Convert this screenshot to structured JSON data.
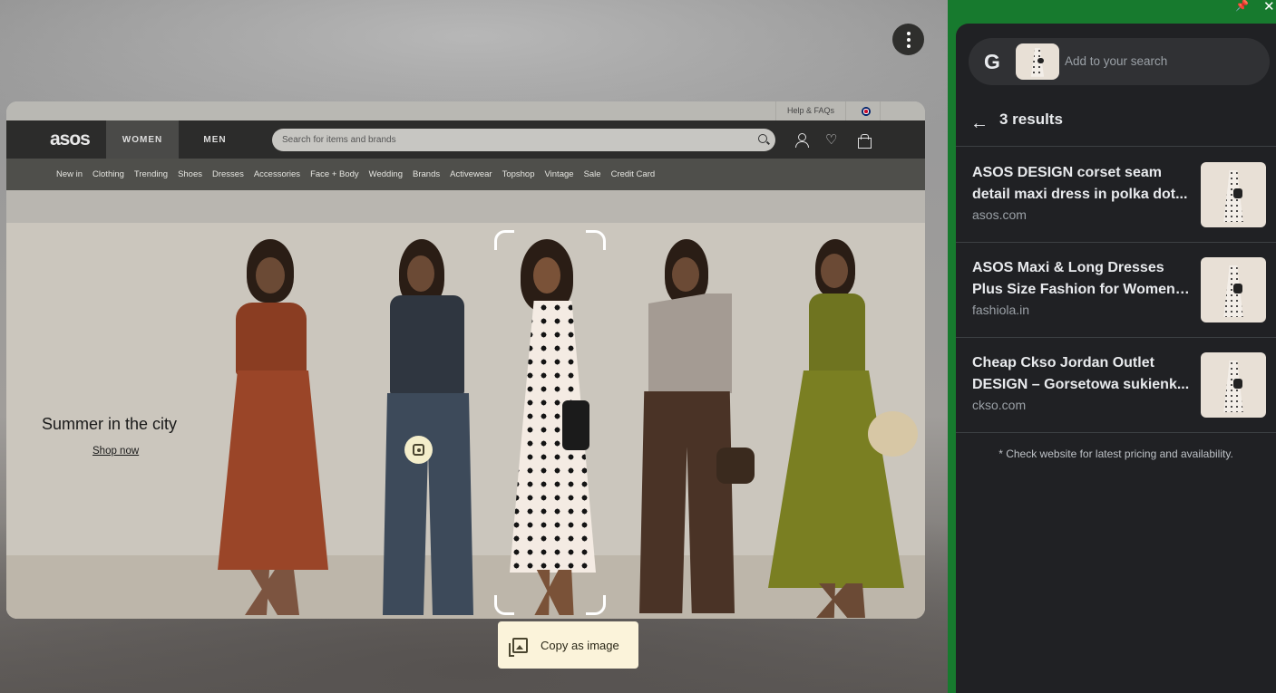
{
  "screen": {
    "menu_icon": "more-vert-icon"
  },
  "site": {
    "utility": {
      "help": "Help & FAQs",
      "flag_icon": "uk-flag-icon"
    },
    "logo": "asos",
    "tabs": [
      "WOMEN",
      "MEN"
    ],
    "search_placeholder": "Search for items and brands",
    "categories": [
      "New in",
      "Clothing",
      "Trending",
      "Shoes",
      "Dresses",
      "Accessories",
      "Face + Body",
      "Wedding",
      "Brands",
      "Activewear",
      "Topshop",
      "Vintage",
      "Sale",
      "Credit Card"
    ],
    "hero": {
      "title": "Summer in the city",
      "cta": "Shop now"
    }
  },
  "lens": {
    "copy_label": "Copy as image"
  },
  "panel": {
    "search_placeholder": "Add to your search",
    "results_count": "3 results",
    "results": [
      {
        "title_line1": "ASOS DESIGN corset seam",
        "title_line2": "detail maxi dress in polka dot...",
        "site": "asos.com"
      },
      {
        "title_line1": "ASOS Maxi & Long Dresses",
        "title_line2": "Plus Size Fashion for Women ...",
        "site": "fashiola.in"
      },
      {
        "title_line1": "Cheap Ckso Jordan Outlet",
        "title_line2": "DESIGN – Gorsetowa sukienk...",
        "site": "ckso.com"
      }
    ],
    "disclaimer": "* Check website for latest pricing and availability."
  },
  "colors": {
    "panel_bg": "#202124",
    "frame_green": "#177a2e",
    "accent_yellow": "#fbf3da"
  }
}
